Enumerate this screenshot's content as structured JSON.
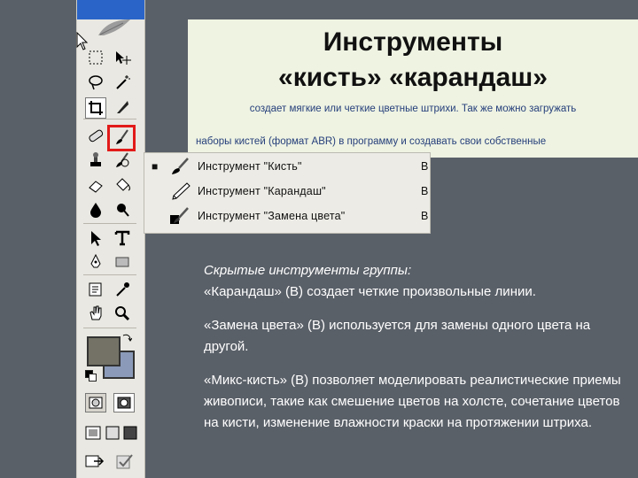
{
  "title": {
    "line1": "Инструменты",
    "line2": "«кисть» «карандаш»"
  },
  "subtitle": {
    "line1": "создает мягкие или четкие цветные штрихи. Так же можно загружать",
    "line2": "наборы кистей (формат ABR) в программу и создавать свои собственные"
  },
  "menu": {
    "items": [
      {
        "label": "Инструмент \"Кисть\"",
        "shortcut": "B",
        "selected": true
      },
      {
        "label": "Инструмент \"Карандаш\"",
        "shortcut": "B",
        "selected": false
      },
      {
        "label": "Инструмент \"Замена цвета\"",
        "shortcut": "B",
        "selected": false
      }
    ]
  },
  "body": {
    "heading": "Скрытые инструменты группы:",
    "p1": "«Карандаш» (В) создает четкие произвольные линии.",
    "p2": "«Замена цвета» (В) используется для замены одного цвета на другой.",
    "p3": "«Микс-кисть» (В) позволяет моделировать реалистические приемы живописи, такие как смешение цветов на холсте, сочетание цветов на кисти, изменение влажности краски на протяжении штриха."
  },
  "colors": {
    "foreground": "#747266",
    "background": "#8a9ab8",
    "highlight": "#e21a1a",
    "title_bg": "#eef3e2",
    "slide_bg": "#5a6068"
  },
  "toolbar": {
    "tools": [
      "marquee-tool-icon",
      "move-tool-icon",
      "lasso-tool-icon",
      "magic-wand-icon",
      "crop-tool-icon",
      "slice-tool-icon",
      "healing-brush-icon",
      "brush-tool-icon",
      "clone-stamp-icon",
      "history-brush-icon",
      "eraser-tool-icon",
      "paint-bucket-icon",
      "blur-tool-icon",
      "dodge-tool-icon",
      "path-selection-icon",
      "type-tool-icon",
      "pen-tool-icon",
      "rectangle-tool-icon",
      "notes-tool-icon",
      "eyedropper-icon",
      "hand-tool-icon",
      "zoom-tool-icon"
    ]
  }
}
